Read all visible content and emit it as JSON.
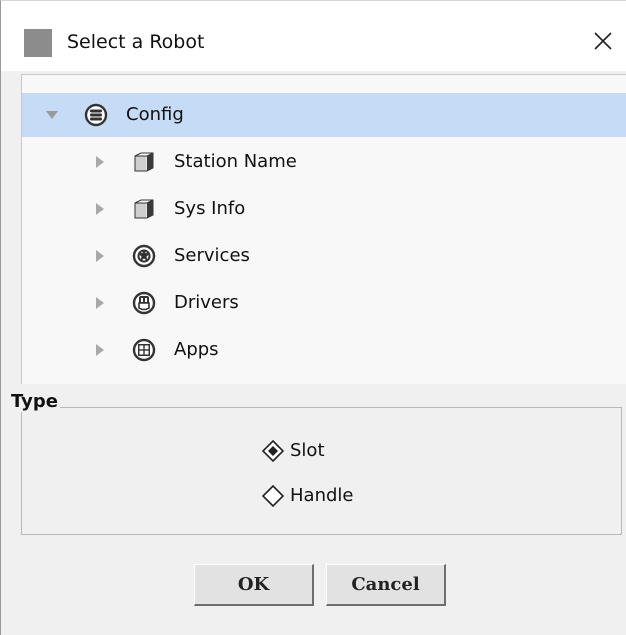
{
  "dialog": {
    "title": "Select a Robot"
  },
  "tree": {
    "root": {
      "label": "Config",
      "icon": "database-icon",
      "expanded": true,
      "selected": true
    },
    "children": [
      {
        "label": "Station Name",
        "icon": "cube-icon"
      },
      {
        "label": "Sys Info",
        "icon": "cube-icon"
      },
      {
        "label": "Services",
        "icon": "services-icon"
      },
      {
        "label": "Drivers",
        "icon": "drivers-icon"
      },
      {
        "label": "Apps",
        "icon": "apps-icon"
      }
    ]
  },
  "type_group": {
    "legend": "Type",
    "options": [
      {
        "label": "Slot",
        "selected": true
      },
      {
        "label": "Handle",
        "selected": false
      }
    ]
  },
  "buttons": {
    "ok": "OK",
    "cancel": "Cancel"
  },
  "colors": {
    "selection": "#c6dcf6",
    "dialog_bg": "#f0f0f0",
    "tree_bg": "#f8f8f8"
  }
}
